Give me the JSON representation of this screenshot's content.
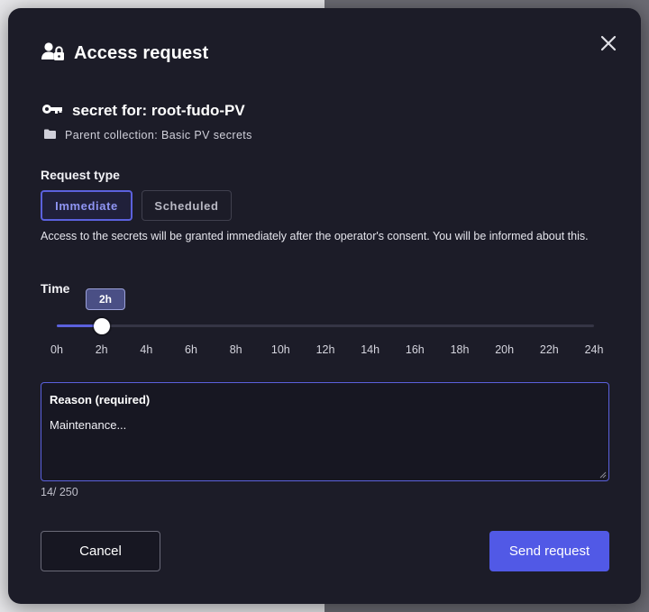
{
  "dialog": {
    "title": "Access request",
    "icons": {
      "title": "user-lock-icon",
      "close": "close-icon",
      "secret": "key-icon",
      "collection": "folder-icon"
    },
    "secret_title": "secret for: root-fudo-PV",
    "parent_collection": "Parent collection: Basic PV secrets"
  },
  "request_type": {
    "label": "Request type",
    "options": [
      "Immediate",
      "Scheduled"
    ],
    "selected": "Immediate",
    "description": "Access to the secrets will be granted immediately after the operator's consent. You will be informed about this."
  },
  "time": {
    "label": "Time",
    "value_label": "2h",
    "value_hours": 2,
    "min_hours": 0,
    "max_hours": 24,
    "ticks": [
      "0h",
      "2h",
      "4h",
      "6h",
      "8h",
      "10h",
      "12h",
      "14h",
      "16h",
      "18h",
      "20h",
      "22h",
      "24h"
    ]
  },
  "reason": {
    "label": "Reason (required)",
    "value": "Maintenance...",
    "counter": "14/ 250"
  },
  "actions": {
    "cancel": "Cancel",
    "send": "Send request"
  },
  "colors": {
    "modal_bg": "#1c1c28",
    "accent": "#5b61dd",
    "send_button": "#5159e6"
  }
}
